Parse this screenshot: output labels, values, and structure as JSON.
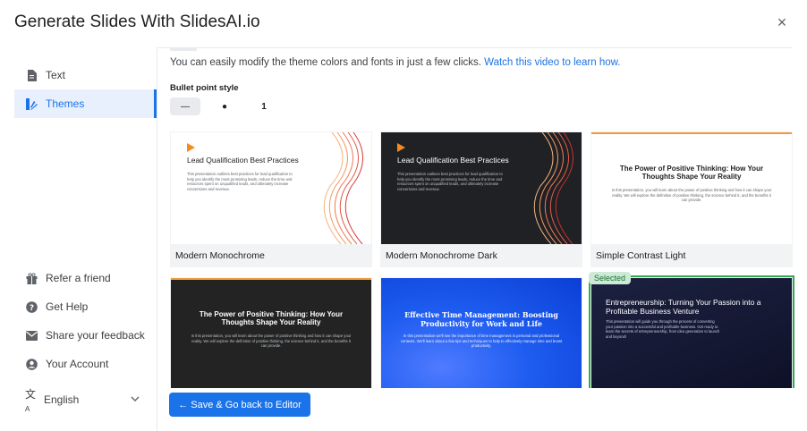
{
  "header": {
    "title": "Generate Slides With SlidesAI.io",
    "close_icon": "×"
  },
  "sidebar": {
    "items": [
      {
        "label": "Text",
        "icon": "document-icon"
      },
      {
        "label": "Themes",
        "icon": "themes-icon",
        "active": true
      },
      {
        "label": "Refer a friend",
        "icon": "gift-icon"
      },
      {
        "label": "Get Help",
        "icon": "help-icon"
      },
      {
        "label": "Share your feedback",
        "icon": "mail-icon"
      },
      {
        "label": "Your Account",
        "icon": "account-icon"
      }
    ],
    "language": {
      "label": "English",
      "icon": "translate-icon"
    }
  },
  "main": {
    "intro_text": "You can easily modify the theme colors and fonts in just a few clicks.",
    "intro_link": "Watch this video to learn how.",
    "bullet_label": "Bullet point style",
    "bullet_options": [
      "—",
      "●",
      "1"
    ],
    "themes": [
      {
        "name": "Modern Monochrome",
        "slide_title": "Lead Qualification Best Practices",
        "slide_body": "This presentation outlines best practices for lead qualification to help you identify the most promising leads, reduce the time and resources spent on unqualified leads, and ultimately increase conversions and revenue."
      },
      {
        "name": "Modern Monochrome Dark",
        "slide_title": "Lead Qualification Best Practices",
        "slide_body": "This presentation outlines best practices for lead qualification to help you identify the most promising leads, reduce the time and resources spent on unqualified leads, and ultimately increase conversions and revenue."
      },
      {
        "name": "Simple Contrast Light",
        "slide_title": "The Power of Positive Thinking: How Your Thoughts Shape Your Reality",
        "slide_body": "In this presentation, you will learn about the power of positive thinking and how it can shape your reality. We will explore the definition of positive thinking, the science behind it, and the benefits it can provide."
      },
      {
        "name": "",
        "slide_title": "The Power of Positive Thinking: How Your Thoughts Shape Your Reality",
        "slide_body": "In this presentation, you will learn about the power of positive thinking and how it can shape your reality. We will explore the definition of positive thinking, the science behind it, and the benefits it can provide."
      },
      {
        "name": "",
        "slide_title": "Effective Time Management: Boosting Productivity for Work and Life",
        "slide_body": "In this presentation we'll see the importance of time management in personal and professional contexts. We'll learn about a few tips and techniques to help to effectively manage time and boost productivity."
      },
      {
        "name": "",
        "slide_title": "Entrepreneurship: Turning Your Passion into a Profitable Business Venture",
        "slide_body": "This presentation will guide you through the process of converting your passion into a successful and profitable business. Get ready to learn the secrets of entrepreneurship, from idea generation to launch and beyond!",
        "badge": "Selected"
      }
    ],
    "save_button": "← Save & Go back to Editor"
  },
  "colors": {
    "accent": "#1a73e8",
    "selected": "#34a853",
    "orange": "#f28b20"
  }
}
